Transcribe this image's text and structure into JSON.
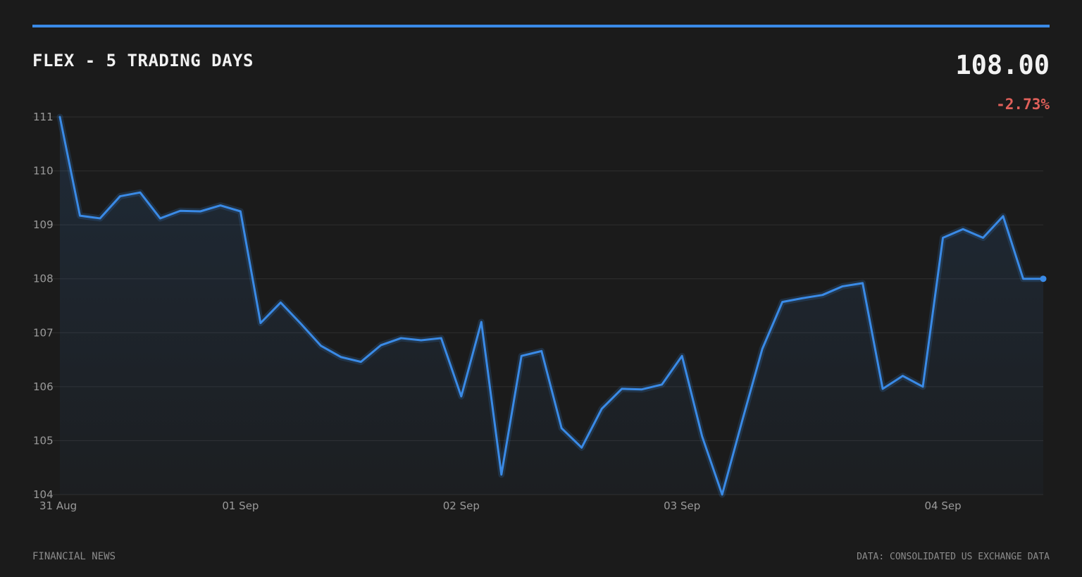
{
  "header": {
    "title": "FLEX - 5 TRADING DAYS",
    "price": "108.00",
    "change": "-2.73%"
  },
  "footer": {
    "source_left": "FINANCIAL NEWS",
    "source_right": "DATA: CONSOLIDATED US EXCHANGE DATA"
  },
  "colors": {
    "background": "#1b1b1b",
    "accent": "#3a8ae6",
    "line": "#3a8ae6",
    "negative": "#e0605a",
    "grid": "#2f2f2f",
    "text": "#f2f2f2",
    "muted": "#9a9a9a"
  },
  "chart_data": {
    "type": "area",
    "title": "FLEX - 5 TRADING DAYS",
    "xlabel": "",
    "ylabel": "",
    "ylim": [
      104,
      111
    ],
    "yticks": [
      104,
      105,
      106,
      107,
      108,
      109,
      110,
      111
    ],
    "grid": true,
    "xticks": [
      {
        "label": "31 Aug",
        "index": 0
      },
      {
        "label": "01 Sep",
        "index": 9
      },
      {
        "label": "02 Sep",
        "index": 20
      },
      {
        "label": "03 Sep",
        "index": 31
      },
      {
        "label": "04 Sep",
        "index": 44
      }
    ],
    "values": [
      111.0,
      109.17,
      109.12,
      109.53,
      109.6,
      109.12,
      109.26,
      109.25,
      109.36,
      109.25,
      107.18,
      107.56,
      107.17,
      106.76,
      106.55,
      106.46,
      106.77,
      106.9,
      106.86,
      106.9,
      105.82,
      107.2,
      104.37,
      106.57,
      106.66,
      105.23,
      104.87,
      105.59,
      105.96,
      105.95,
      106.04,
      106.57,
      105.08,
      104.0,
      105.37,
      106.7,
      107.57,
      107.64,
      107.7,
      107.86,
      107.92,
      105.96,
      106.2,
      106.0,
      108.76,
      108.92,
      108.76,
      109.16,
      108.0,
      108.0
    ]
  }
}
